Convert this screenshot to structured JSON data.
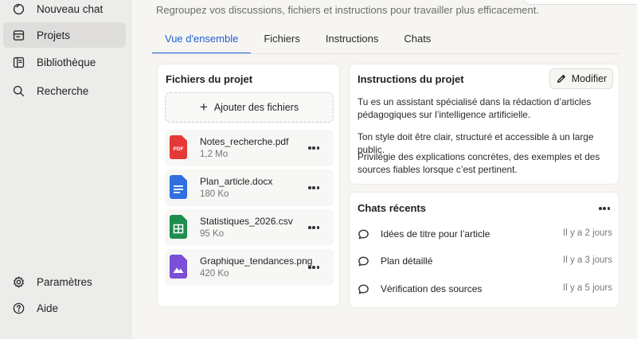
{
  "sidebar": {
    "items": [
      {
        "label": "Nouveau chat",
        "icon": "new-chat-icon"
      },
      {
        "label": "Projets",
        "icon": "folder-icon",
        "active": true
      },
      {
        "label": "Bibliothèque",
        "icon": "library-icon"
      },
      {
        "label": "Recherche",
        "icon": "search-icon"
      }
    ],
    "bottom_items": [
      {
        "label": "Paramètres",
        "icon": "gear-icon"
      },
      {
        "label": "Aide",
        "icon": "help-icon"
      }
    ]
  },
  "header": {
    "subtitle": "Regroupez vos discussions, fichiers et instructions pour travailler plus efficacement."
  },
  "tabs": [
    {
      "label": "Vue d'ensemble",
      "active": true
    },
    {
      "label": "Fichiers"
    },
    {
      "label": "Instructions"
    },
    {
      "label": "Chats"
    }
  ],
  "files": {
    "title": "Fichiers du projet",
    "add_label": "Ajouter des fichiers",
    "items": [
      {
        "name": "Notes_recherche.pdf",
        "size": "1,2 Mo",
        "type": "pdf",
        "icon_label": "PDF",
        "color": "#e53935"
      },
      {
        "name": "Plan_article.docx",
        "size": "180 Ko",
        "type": "docx",
        "color": "#2f6fe0"
      },
      {
        "name": "Statistiques_2026.csv",
        "size": "95 Ko",
        "type": "csv",
        "color": "#1e8e4e"
      },
      {
        "name": "Graphique_tendances.png",
        "size": "420 Ko",
        "type": "png",
        "color": "#7b4fd6"
      }
    ]
  },
  "instructions": {
    "title": "Instructions du projet",
    "edit_label": "Modifier",
    "paragraphs": [
      "Tu es un assistant spécialisé dans la rédaction d’articles pédagogiques sur l’intelligence artificielle.",
      "Ton style doit être clair, structuré et accessible à un large public.",
      "Privilégie des explications concrètes, des exemples et des sources fiables lorsque c’est pertinent."
    ]
  },
  "chats": {
    "title": "Chats récents",
    "items": [
      {
        "title": "Idées de titre pour l’article",
        "time": "Il y a 2 jours"
      },
      {
        "title": "Plan détaillé",
        "time": "Il y a 3 jours"
      },
      {
        "title": "Vérification des sources",
        "time": "Il y a 5 jours"
      }
    ]
  },
  "colors": {
    "accent": "#2465d8",
    "sidebar_bg": "#ececea",
    "active_item_bg": "#dedddb"
  }
}
